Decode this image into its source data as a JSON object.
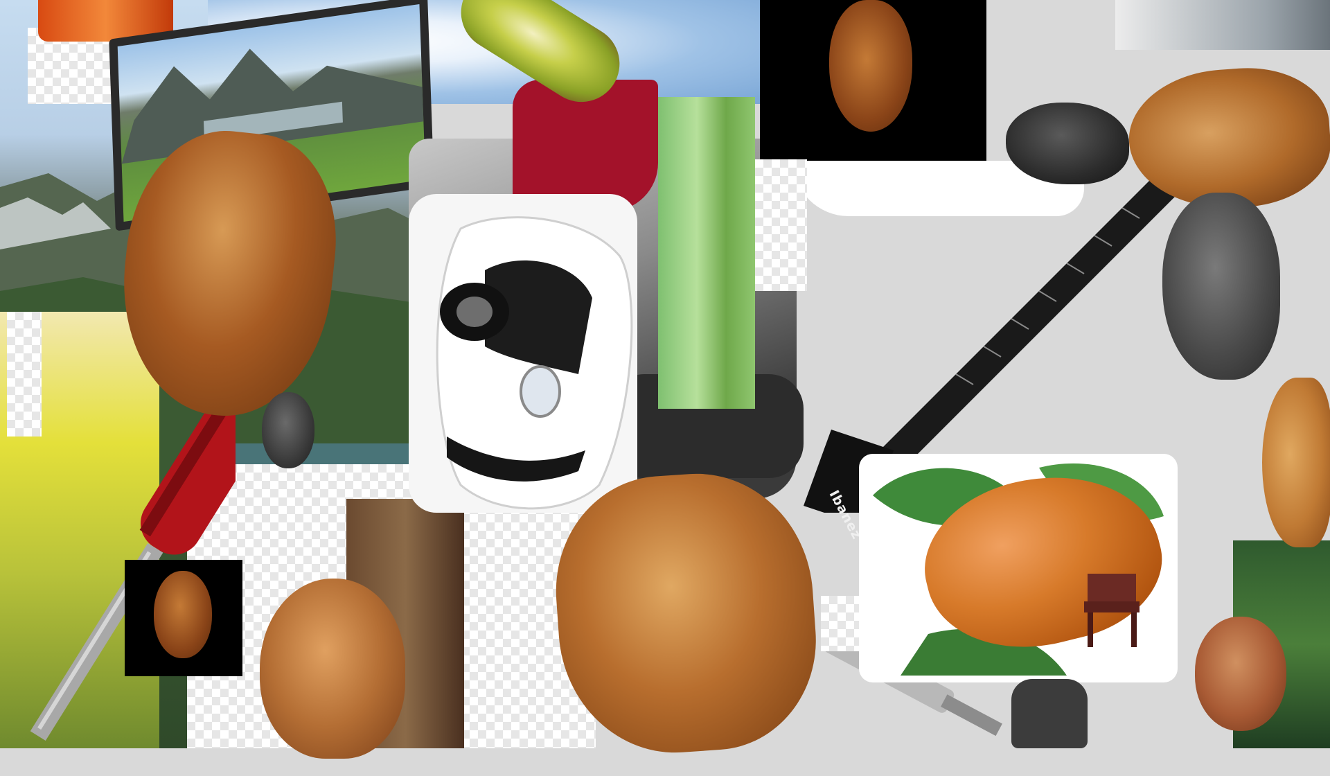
{
  "scene": {
    "description_kind": "photo-collage",
    "objects": [
      "date-fruit",
      "mountain-landscape",
      "computer-monitor",
      "kiwi-slice",
      "screwdriver",
      "white-sports-car",
      "office-chair",
      "electric-guitar",
      "strawberry",
      "dark-dried-fruit",
      "wooden-chair"
    ]
  },
  "guitar": {
    "brand_label": "Ibanez"
  },
  "colors": {
    "date_dark": "#6b3510",
    "date_mid": "#a65a22",
    "date_light": "#d79a55",
    "sky": "#bcd6ee",
    "mountain": "#5d6b55",
    "grass": "#6f9c3a",
    "red_handle": "#b2141a",
    "guitar_body": "#1a1a1a",
    "strawberry": "#c9661e",
    "leaf": "#3f8a3a",
    "panel_black": "#000000",
    "background_gray": "#d9d9d9"
  }
}
